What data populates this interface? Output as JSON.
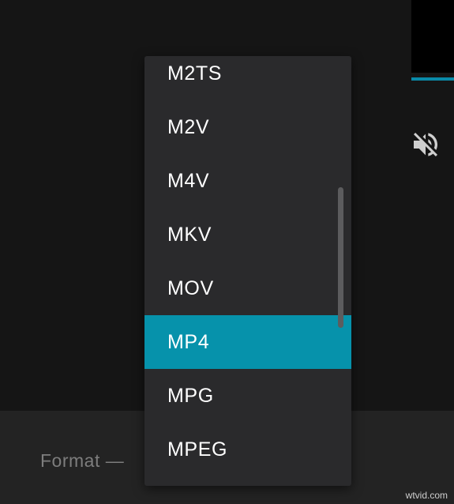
{
  "format": {
    "label": "Format",
    "separator": "—"
  },
  "dropdown": {
    "options": [
      "M2TS",
      "M2V",
      "M4V",
      "MKV",
      "MOV",
      "MP4",
      "MPG",
      "MPEG"
    ],
    "selected": "MP4"
  },
  "preview": {
    "mute_icon": "speaker-muted-icon"
  },
  "watermark": "wtvid.com",
  "colors": {
    "accent": "#0692ab",
    "background": "#151515",
    "menu": "#2a2a2c",
    "bottom_bar": "#232323",
    "label": "#7d7d7d"
  }
}
